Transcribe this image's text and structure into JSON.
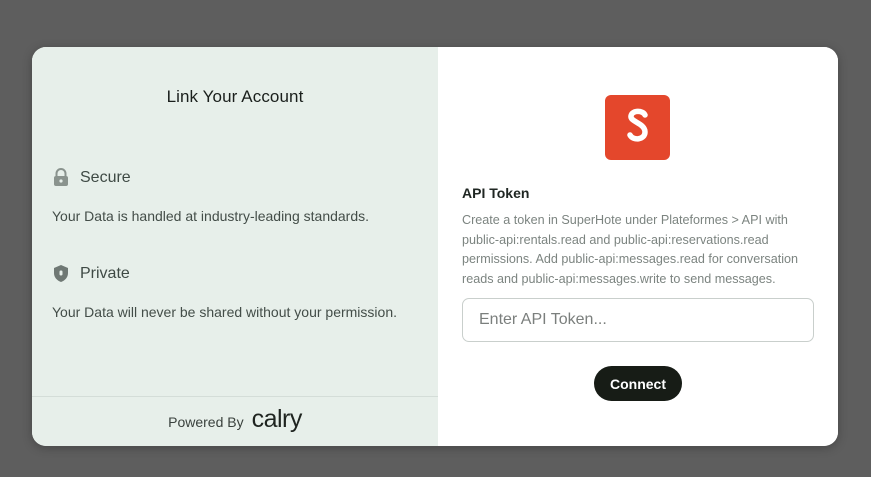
{
  "left": {
    "title": "Link Your Account",
    "features": [
      {
        "icon": "lock-icon",
        "heading": "Secure",
        "text": "Your Data is handled at industry-leading standards."
      },
      {
        "icon": "shield-icon",
        "heading": "Private",
        "text": "Your Data will never be shared without your permission."
      }
    ],
    "footer": {
      "powered_label": "Powered By",
      "brand": "calry"
    }
  },
  "right": {
    "logo": {
      "letter": "S",
      "color": "#e4472c"
    },
    "token": {
      "label": "API Token",
      "help": "Create a token in SuperHote under Plateformes > API with public-api:rentals.read and public-api:reservations.read permissions. Add public-api:messages.read for conversation reads and public-api:messages.write to send messages.",
      "placeholder": "Enter API Token...",
      "value": ""
    },
    "connect_label": "Connect"
  },
  "colors": {
    "backdrop": "#5e5e5e",
    "left_panel": "#e7efea",
    "logo": "#e4472c",
    "button": "#171c16"
  }
}
